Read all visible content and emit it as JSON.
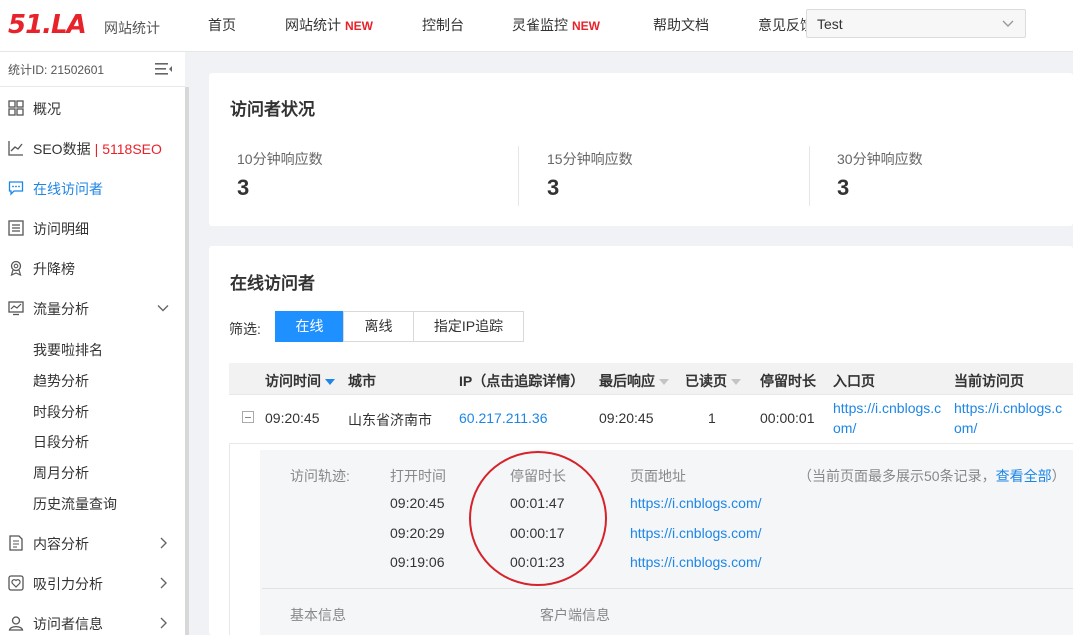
{
  "header": {
    "logo": "51.LA",
    "logo_sub": "网站统计",
    "nav": [
      {
        "label": "首页",
        "badge": ""
      },
      {
        "label": "网站统计",
        "badge": "NEW"
      },
      {
        "label": "控制台",
        "badge": ""
      },
      {
        "label": "灵雀监控",
        "badge": "NEW"
      },
      {
        "label": "帮助文档",
        "badge": ""
      },
      {
        "label": "意见反馈",
        "badge": ""
      }
    ],
    "site_select": {
      "value": "Test"
    }
  },
  "sidebar": {
    "stat_id": "统计ID: 21502601",
    "items": [
      {
        "label": "概况",
        "icon": "grid-icon"
      },
      {
        "label": "SEO数据",
        "icon": "line-chart-icon",
        "extra": "5118SEO"
      },
      {
        "label": "在线访问者",
        "icon": "chat-icon",
        "active": true
      },
      {
        "label": "访问明细",
        "icon": "list-icon"
      },
      {
        "label": "升降榜",
        "icon": "award-icon"
      },
      {
        "label": "流量分析",
        "icon": "traffic-icon",
        "expanded": true
      },
      {
        "label": "内容分析",
        "icon": "document-icon"
      },
      {
        "label": "吸引力分析",
        "icon": "heart-icon"
      },
      {
        "label": "访问者信息",
        "icon": "user-icon"
      }
    ],
    "traffic_sub": [
      "我要啦排名",
      "趋势分析",
      "时段分析",
      "日段分析",
      "周月分析",
      "历史流量查询"
    ]
  },
  "visitor_status": {
    "title": "访问者状况",
    "metrics": [
      {
        "label": "10分钟响应数",
        "value": "3"
      },
      {
        "label": "15分钟响应数",
        "value": "3"
      },
      {
        "label": "30分钟响应数",
        "value": "3"
      }
    ]
  },
  "online": {
    "title": "在线访问者",
    "filter_label": "筛选:",
    "filters": [
      "在线",
      "离线",
      "指定IP追踪"
    ],
    "columns": [
      "访问时间",
      "城市",
      "IP（点击追踪详情）",
      "最后响应",
      "已读页",
      "停留时长",
      "入口页",
      "当前访问页"
    ],
    "rows": [
      {
        "time": "09:20:45",
        "city": "山东省济南市",
        "ip": "60.217.211.36",
        "last": "09:20:45",
        "pages": "1",
        "duration": "00:00:01",
        "entry_1": "https://i.cnblogs.c",
        "entry_2": "om/",
        "current_1": "https://i.cnblogs.c",
        "current_2": "om/"
      }
    ],
    "detail": {
      "label": "访问轨迹:",
      "col_open": "打开时间",
      "col_stay": "停留时长",
      "col_url": "页面地址",
      "note": "（当前页面最多展示50条记录，",
      "view_all": "查看全部",
      "note_end": "）",
      "track": [
        {
          "open": "09:20:45",
          "stay": "00:01:47",
          "url": "https://i.cnblogs.com/"
        },
        {
          "open": "09:20:29",
          "stay": "00:00:17",
          "url": "https://i.cnblogs.com/"
        },
        {
          "open": "09:19:06",
          "stay": "00:01:23",
          "url": "https://i.cnblogs.com/"
        }
      ],
      "basic_info": "基本信息",
      "client_info": "客户端信息"
    }
  },
  "colors": {
    "brand": "#e8222a",
    "accent": "#1e86e6",
    "annotation": "#d6222a"
  }
}
